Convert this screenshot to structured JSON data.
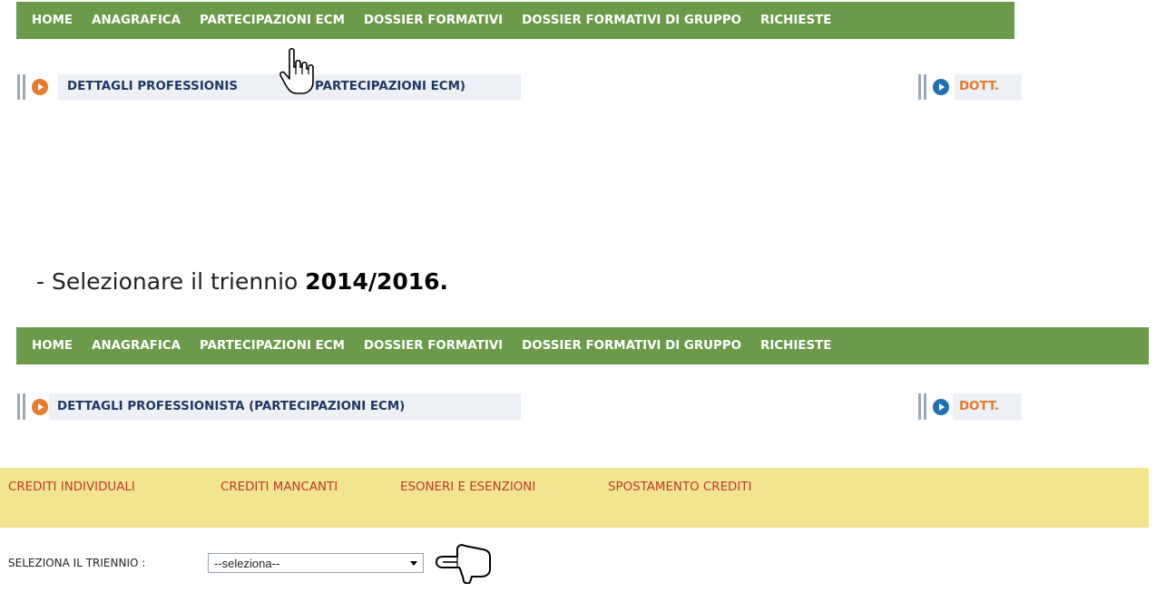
{
  "nav": {
    "items": [
      "HOME",
      "ANAGRAFICA",
      "PARTECIPAZIONI ECM",
      "DOSSIER FORMATIVI",
      "DOSSIER FORMATIVI DI GRUPPO",
      "RICHIESTE"
    ]
  },
  "details": {
    "title_partial_left": "DETTAGLI PROFESSIONIS",
    "title_partial_right": "PARTECIPAZIONI ECM)",
    "title": "DETTAGLI PROFESSIONISTA (PARTECIPAZIONI ECM)",
    "doctor_label": "DOTT."
  },
  "instruction": {
    "prefix": "- Selezionare il triennio ",
    "highlight": "2014/2016."
  },
  "subnav": {
    "items": [
      "CREDITI INDIVIDUALI",
      "CREDITI MANCANTI",
      "ESONERI E ESENZIONI",
      "SPOSTAMENTO CREDITI"
    ]
  },
  "triennio": {
    "label": "SELEZIONA IL TRIENNIO :",
    "value": "--seleziona--"
  },
  "icons": [
    "hand-pointer-cursor-icon",
    "hand-pointing-left-icon",
    "chevron-right-circle-icon"
  ],
  "colors": {
    "nav_bg": "#6b9a4a",
    "subnav_bg": "#f1e68f",
    "subnav_text": "#c0392b",
    "orange_accent": "#e87a2c",
    "blue_accent": "#1f6fb2",
    "title_text": "#1f3864"
  }
}
